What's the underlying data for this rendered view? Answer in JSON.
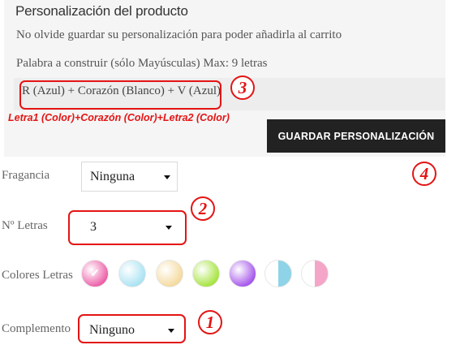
{
  "customization": {
    "title": "Personalización del producto",
    "note": "No olvide guardar su personalización para poder añadirla al carrito",
    "word_label": "Palabra a construir (sólo Mayúsculas) Max: 9 letras",
    "word_value": "R (Azul) + Corazón (Blanco) + V (Azul)",
    "hint": "Letra1 (Color)+Corazón (Color)+Letra2 (Color)",
    "save_button": "GUARDAR PERSONALIZACIÓN"
  },
  "options": {
    "fragrance": {
      "label": "Fragancia",
      "value": "Ninguna"
    },
    "letters": {
      "label": "Nº Letras",
      "value": "3"
    },
    "colors": {
      "label": "Colores Letras",
      "swatches": [
        {
          "name": "pink",
          "color": "#ec5aa5",
          "selected": true
        },
        {
          "name": "light-blue",
          "color": "#a7e2f2",
          "selected": false
        },
        {
          "name": "cream",
          "color": "#f4d99b",
          "selected": false
        },
        {
          "name": "lime-green",
          "color": "#a4e33b",
          "selected": false
        },
        {
          "name": "purple",
          "color": "#a351ea",
          "selected": false
        },
        {
          "name": "white-blue",
          "color": "#8fd3e8",
          "selected": false
        },
        {
          "name": "white-pink",
          "color": "#f5a5c8",
          "selected": false
        }
      ]
    },
    "complement": {
      "label": "Complemento",
      "value": "Ninguno"
    }
  },
  "annotations": {
    "complement_marker": "1",
    "letters_marker": "2",
    "word_marker": "3",
    "save_marker": "4",
    "color": "#e41414"
  }
}
